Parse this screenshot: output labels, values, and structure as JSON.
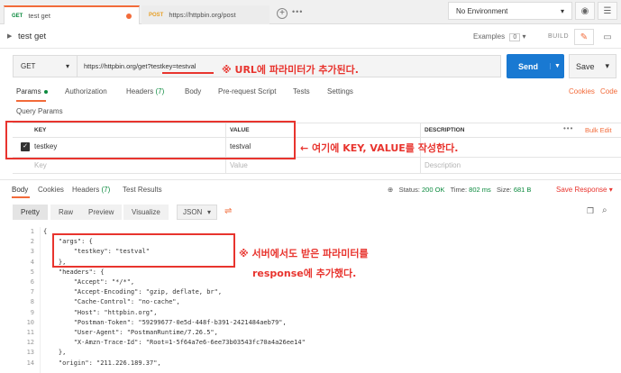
{
  "tabs": [
    {
      "method": "GET",
      "label": "test get"
    },
    {
      "method": "POST",
      "label": "https://httpbin.org/post"
    }
  ],
  "environment": {
    "selected": "No Environment"
  },
  "request": {
    "title": "test get",
    "examples_label": "Examples",
    "examples_count": "0",
    "build_label": "BUILD",
    "method": "GET",
    "url": "https://httpbin.org/get?testkey=testval",
    "send_label": "Send",
    "save_label": "Save"
  },
  "request_tabs": {
    "params": "Params",
    "authorization": "Authorization",
    "headers": "Headers",
    "headers_count": "(7)",
    "body": "Body",
    "pre_request": "Pre-request Script",
    "tests": "Tests",
    "settings": "Settings",
    "cookies": "Cookies",
    "code": "Code"
  },
  "query_params": {
    "label": "Query Params",
    "headers": {
      "key": "KEY",
      "value": "VALUE",
      "description": "DESCRIPTION",
      "bulk_edit": "Bulk Edit"
    },
    "rows": [
      {
        "key": "testkey",
        "value": "testval"
      }
    ],
    "placeholder": {
      "key": "Key",
      "value": "Value",
      "description": "Description"
    }
  },
  "response_tabs": {
    "body": "Body",
    "cookies": "Cookies",
    "headers": "Headers",
    "headers_count": "(7)",
    "test_results": "Test Results",
    "status_label": "Status:",
    "status_value": "200 OK",
    "time_label": "Time:",
    "time_value": "802 ms",
    "size_label": "Size:",
    "size_value": "681 B",
    "save_response": "Save Response"
  },
  "body_toolbar": {
    "pretty": "Pretty",
    "raw": "Raw",
    "preview": "Preview",
    "visualize": "Visualize",
    "format": "JSON"
  },
  "code_lines": [
    {
      "n": "1",
      "text": "{"
    },
    {
      "n": "2",
      "text": "    \"args\": {"
    },
    {
      "n": "3",
      "text": "        \"testkey\": \"testval\""
    },
    {
      "n": "4",
      "text": "    },"
    },
    {
      "n": "5",
      "text": "    \"headers\": {"
    },
    {
      "n": "6",
      "text": "        \"Accept\": \"*/*\","
    },
    {
      "n": "7",
      "text": "        \"Accept-Encoding\": \"gzip, deflate, br\","
    },
    {
      "n": "8",
      "text": "        \"Cache-Control\": \"no-cache\","
    },
    {
      "n": "9",
      "text": "        \"Host\": \"httpbin.org\","
    },
    {
      "n": "10",
      "text": "        \"Postman-Token\": \"59299677-0e5d-448f-b391-2421484aeb79\","
    },
    {
      "n": "11",
      "text": "        \"User-Agent\": \"PostmanRuntime/7.26.5\","
    },
    {
      "n": "12",
      "text": "        \"X-Amzn-Trace-Id\": \"Root=1-5f64a7e6-6ee73b03543fc70a4a26ee14\""
    },
    {
      "n": "13",
      "text": "    },"
    },
    {
      "n": "14",
      "text": "    \"origin\": \"211.226.189.37\","
    }
  ],
  "annotations": {
    "url_note": "※ URL에 파라미터가 추가된다.",
    "params_note": "← 여기에 KEY, VALUE를 작성한다.",
    "response_note_1": "※ 서버에서도 받은 파라미터를",
    "response_note_2": "response에 추가했다."
  },
  "colors": {
    "accent": "#f26b3a",
    "send": "#1979d2",
    "annotation": "#e8342e",
    "ok": "#0b8a3e"
  }
}
